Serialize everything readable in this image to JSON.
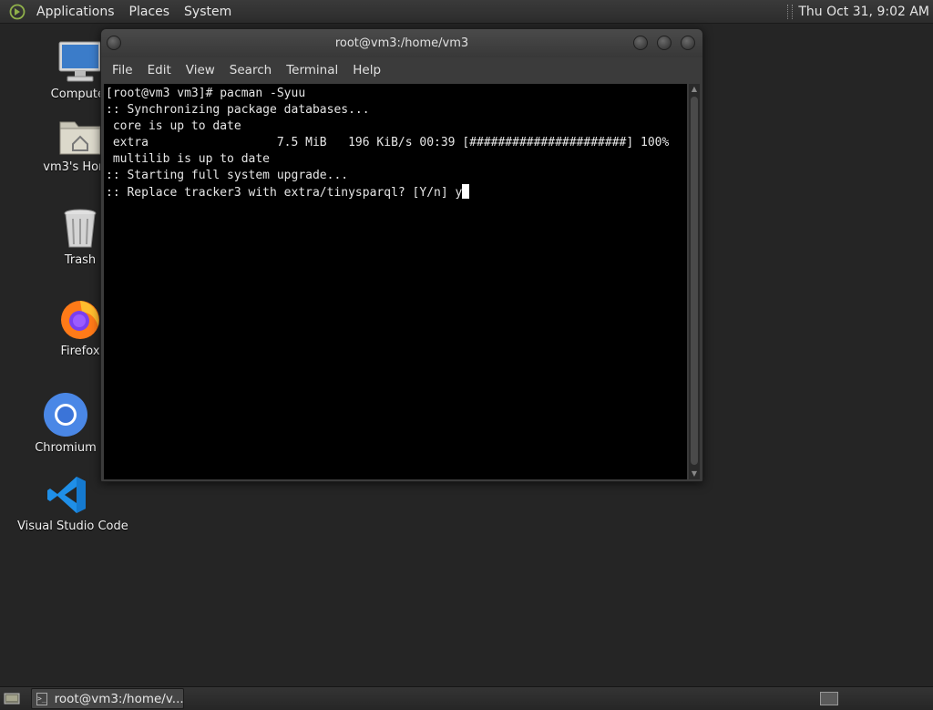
{
  "top_panel": {
    "menus": [
      "Applications",
      "Places",
      "System"
    ],
    "clock": "Thu Oct 31,  9:02 AM"
  },
  "desktop_icons": [
    {
      "label": "Computer",
      "icon": "computer-icon"
    },
    {
      "label": "vm3's Home",
      "icon": "home-folder-icon"
    },
    {
      "label": "Trash",
      "icon": "trash-icon"
    },
    {
      "label": "Firefox",
      "icon": "firefox-icon"
    },
    {
      "label": "Chromium",
      "icon": "chromium-icon"
    },
    {
      "label": "Visual Studio Code",
      "icon": "vscode-icon"
    }
  ],
  "terminal_window": {
    "title": "root@vm3:/home/vm3",
    "menu": [
      "File",
      "Edit",
      "View",
      "Search",
      "Terminal",
      "Help"
    ],
    "lines": [
      "[root@vm3 vm3]# pacman -Syuu",
      ":: Synchronizing package databases...",
      " core is up to date",
      " extra                  7.5 MiB   196 KiB/s 00:39 [######################] 100%",
      " multilib is up to date",
      ":: Starting full system upgrade...",
      ":: Replace tracker3 with extra/tinysparql? [Y/n] y"
    ]
  },
  "taskbar": {
    "task_label": "root@vm3:/home/v..."
  },
  "colors": {
    "desktop_bg": "#252525",
    "terminal_bg": "#000000",
    "terminal_fg": "#e6e6e6"
  }
}
